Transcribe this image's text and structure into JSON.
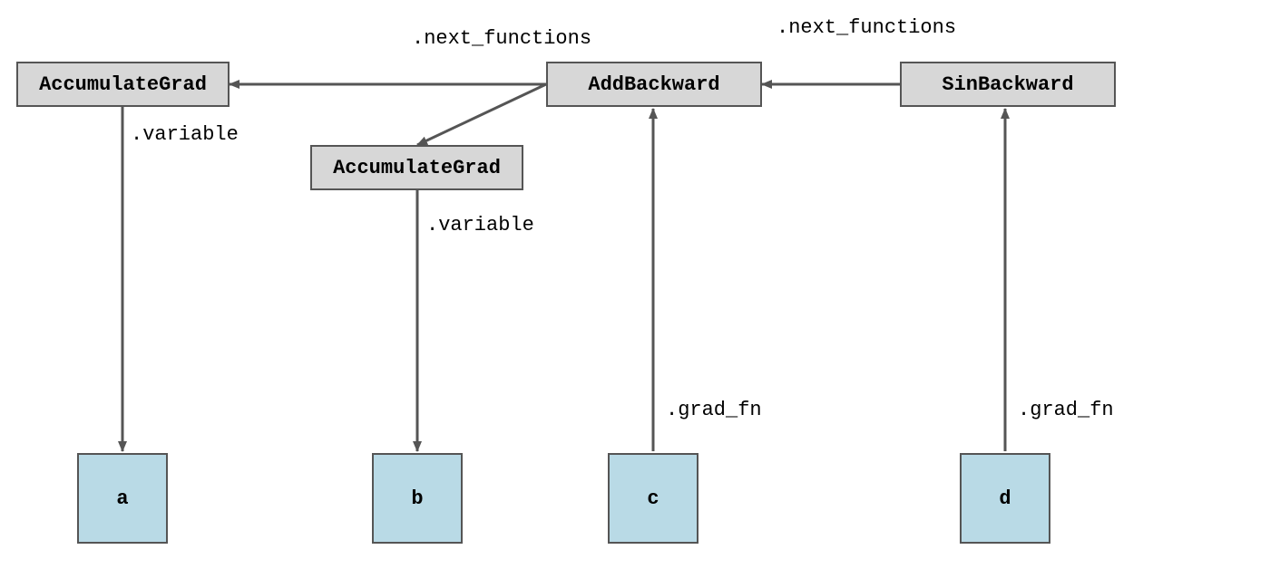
{
  "nodes": {
    "accum_a": "AccumulateGrad",
    "accum_b": "AccumulateGrad",
    "add_backward": "AddBackward",
    "sin_backward": "SinBackward"
  },
  "vars": {
    "a": "a",
    "b": "b",
    "c": "c",
    "d": "d"
  },
  "labels": {
    "next_functions_1": ".next_functions",
    "next_functions_2": ".next_functions",
    "variable_a": ".variable",
    "variable_b": ".variable",
    "grad_fn_c": ".grad_fn",
    "grad_fn_d": ".grad_fn"
  }
}
